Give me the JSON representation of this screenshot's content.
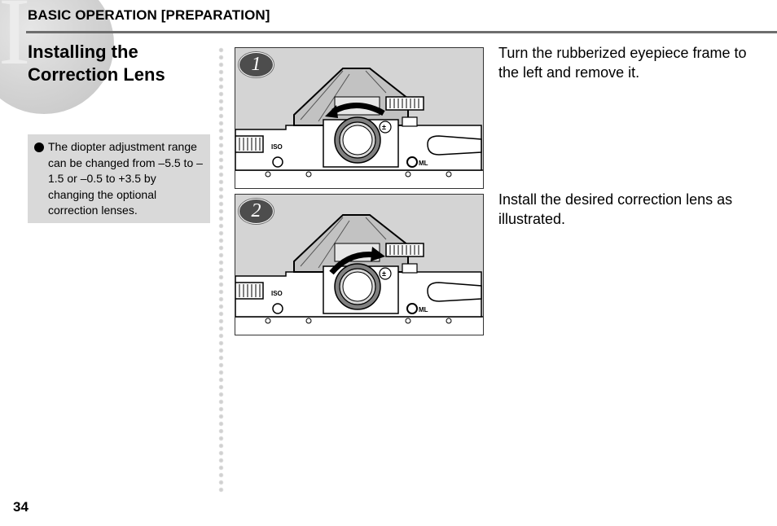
{
  "header": {
    "section_title": "BASIC OPERATION [PREPARATION]",
    "chapter_numeral": "I"
  },
  "page_title_lines": [
    "Installing the",
    "Correction Lens"
  ],
  "note": {
    "bullet_icon": "filled-circle",
    "text": "The diopter adjustment range can be changed from –5.5 to –1.5 or –0.5 to +3.5 by changing the optional correction lenses."
  },
  "steps": [
    {
      "number": "1",
      "text": "Turn the rubberized eyepiece frame to the left and remove it.",
      "illustration": {
        "arrow_direction": "left",
        "labels": [
          "ISO",
          "ML"
        ]
      }
    },
    {
      "number": "2",
      "text": "Install the desired correction lens as illustrated.",
      "illustration": {
        "arrow_direction": "right",
        "labels": [
          "ISO",
          "ML"
        ]
      }
    }
  ],
  "footer": {
    "page_number": "34"
  }
}
